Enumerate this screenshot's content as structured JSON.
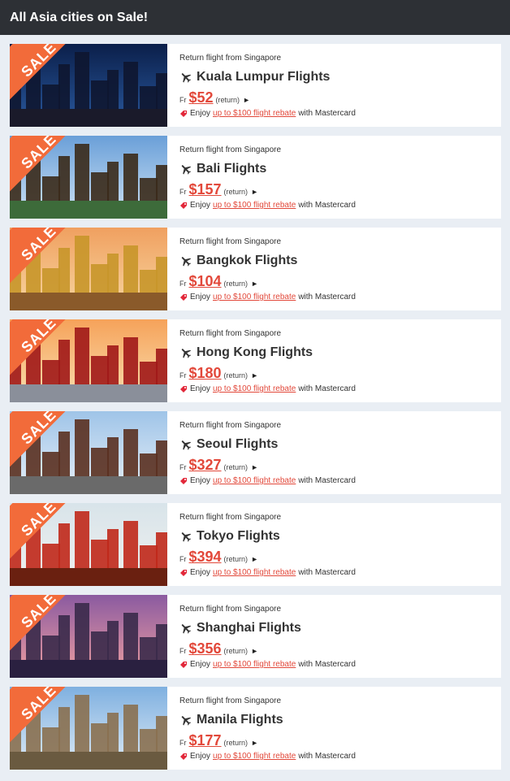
{
  "header": {
    "title": "All Asia cities on Sale!"
  },
  "common": {
    "sale_label": "SALE",
    "subtitle": "Return flight from Singapore",
    "fr_label": "Fr",
    "return_label": "(return)",
    "arrow": "►",
    "promo_prefix": "Enjoy",
    "promo_link": "up to $100 flight rebate",
    "promo_suffix": "with Mastercard"
  },
  "colors": {
    "accent": "#f26b3a",
    "price": "#e2483a",
    "header_bg": "#2d3035",
    "page_bg": "#e9eef4"
  },
  "cities": [
    {
      "title": "Kuala Lumpur Flights",
      "price": "$52"
    },
    {
      "title": "Bali Flights",
      "price": "$157"
    },
    {
      "title": "Bangkok Flights",
      "price": "$104"
    },
    {
      "title": "Hong Kong Flights",
      "price": "$180"
    },
    {
      "title": "Seoul Flights",
      "price": "$327"
    },
    {
      "title": "Tokyo Flights",
      "price": "$394"
    },
    {
      "title": "Shanghai Flights",
      "price": "$356"
    },
    {
      "title": "Manila Flights",
      "price": "$177"
    }
  ]
}
